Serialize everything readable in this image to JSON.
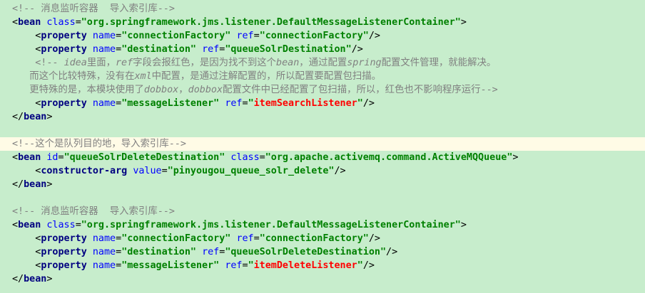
{
  "lines": [
    {
      "indent": 0,
      "tokens": [
        {
          "t": "comment",
          "s": "<!-- 消息监听容器  导入索引库-->"
        }
      ]
    },
    {
      "indent": 0,
      "tokens": [
        {
          "t": "punct",
          "s": "<"
        },
        {
          "t": "tag",
          "s": "bean"
        },
        {
          "t": "punct",
          "s": " "
        },
        {
          "t": "attr",
          "s": "class"
        },
        {
          "t": "punct",
          "s": "="
        },
        {
          "t": "val",
          "s": "\"org.springframework.jms.listener.DefaultMessageListenerContainer\""
        },
        {
          "t": "punct",
          "s": ">"
        }
      ]
    },
    {
      "indent": 4,
      "tokens": [
        {
          "t": "punct",
          "s": "<"
        },
        {
          "t": "tag",
          "s": "property"
        },
        {
          "t": "punct",
          "s": " "
        },
        {
          "t": "attr",
          "s": "name"
        },
        {
          "t": "punct",
          "s": "="
        },
        {
          "t": "val",
          "s": "\"connectionFactory\""
        },
        {
          "t": "punct",
          "s": " "
        },
        {
          "t": "attr",
          "s": "ref"
        },
        {
          "t": "punct",
          "s": "="
        },
        {
          "t": "val",
          "s": "\"connectionFactory\""
        },
        {
          "t": "punct",
          "s": "/>"
        }
      ]
    },
    {
      "indent": 4,
      "tokens": [
        {
          "t": "punct",
          "s": "<"
        },
        {
          "t": "tag",
          "s": "property"
        },
        {
          "t": "punct",
          "s": " "
        },
        {
          "t": "attr",
          "s": "name"
        },
        {
          "t": "punct",
          "s": "="
        },
        {
          "t": "val",
          "s": "\"destination\""
        },
        {
          "t": "punct",
          "s": " "
        },
        {
          "t": "attr",
          "s": "ref"
        },
        {
          "t": "punct",
          "s": "="
        },
        {
          "t": "val",
          "s": "\"queueSolrDestination\""
        },
        {
          "t": "punct",
          "s": "/>"
        }
      ]
    },
    {
      "indent": 4,
      "tokens": [
        {
          "t": "comment",
          "s": "<!-- "
        },
        {
          "t": "comment-i",
          "s": "idea"
        },
        {
          "t": "comment",
          "s": "里面，"
        },
        {
          "t": "comment-i",
          "s": "ref"
        },
        {
          "t": "comment",
          "s": "字段会报红色，是因为找不到这个"
        },
        {
          "t": "comment-i",
          "s": "bean"
        },
        {
          "t": "comment",
          "s": "，通过配置"
        },
        {
          "t": "comment-i",
          "s": "spring"
        },
        {
          "t": "comment",
          "s": "配置文件管理，就能解决。"
        }
      ]
    },
    {
      "indent": 3,
      "tokens": [
        {
          "t": "comment",
          "s": "而这个比较特殊，没有在"
        },
        {
          "t": "comment-i",
          "s": "xml"
        },
        {
          "t": "comment",
          "s": "中配置，是通过注解配置的，所以配置要配置包扫描。"
        }
      ]
    },
    {
      "indent": 3,
      "tokens": [
        {
          "t": "comment",
          "s": "更特殊的是，本模块使用了"
        },
        {
          "t": "comment-i",
          "s": "dobbox"
        },
        {
          "t": "comment",
          "s": "，"
        },
        {
          "t": "comment-i",
          "s": "dobbox"
        },
        {
          "t": "comment",
          "s": "配置文件中已经配置了包扫描，所以，红色也不影响程序运行-->"
        }
      ]
    },
    {
      "indent": 4,
      "tokens": [
        {
          "t": "punct",
          "s": "<"
        },
        {
          "t": "tag",
          "s": "property"
        },
        {
          "t": "punct",
          "s": " "
        },
        {
          "t": "attr",
          "s": "name"
        },
        {
          "t": "punct",
          "s": "="
        },
        {
          "t": "val",
          "s": "\"messageListener\""
        },
        {
          "t": "punct",
          "s": " "
        },
        {
          "t": "attr",
          "s": "ref"
        },
        {
          "t": "punct",
          "s": "="
        },
        {
          "t": "val",
          "s": "\""
        },
        {
          "t": "val-red",
          "s": "itemSearchListener"
        },
        {
          "t": "val",
          "s": "\""
        },
        {
          "t": "punct",
          "s": "/>"
        }
      ]
    },
    {
      "indent": 0,
      "tokens": [
        {
          "t": "punct",
          "s": "</"
        },
        {
          "t": "tag",
          "s": "bean"
        },
        {
          "t": "punct",
          "s": ">"
        }
      ]
    },
    {
      "indent": 0,
      "tokens": []
    },
    {
      "indent": 0,
      "current": true,
      "tokens": [
        {
          "t": "comment",
          "s": "<!--这个是队列目的地，导入索引库-->"
        }
      ]
    },
    {
      "indent": 0,
      "tokens": [
        {
          "t": "punct",
          "s": "<"
        },
        {
          "t": "tag",
          "s": "bean"
        },
        {
          "t": "punct",
          "s": " "
        },
        {
          "t": "attr",
          "s": "id"
        },
        {
          "t": "punct",
          "s": "="
        },
        {
          "t": "val",
          "s": "\"queueSolrDeleteDestination\""
        },
        {
          "t": "punct",
          "s": " "
        },
        {
          "t": "attr",
          "s": "class"
        },
        {
          "t": "punct",
          "s": "="
        },
        {
          "t": "val",
          "s": "\"org.apache.activemq.command.ActiveMQQueue\""
        },
        {
          "t": "punct",
          "s": ">"
        }
      ]
    },
    {
      "indent": 4,
      "tokens": [
        {
          "t": "punct",
          "s": "<"
        },
        {
          "t": "tag",
          "s": "constructor-arg"
        },
        {
          "t": "punct",
          "s": " "
        },
        {
          "t": "attr",
          "s": "value"
        },
        {
          "t": "punct",
          "s": "="
        },
        {
          "t": "val",
          "s": "\"pinyougou_queue_solr_delete\""
        },
        {
          "t": "punct",
          "s": "/>"
        }
      ]
    },
    {
      "indent": 0,
      "tokens": [
        {
          "t": "punct",
          "s": "</"
        },
        {
          "t": "tag",
          "s": "bean"
        },
        {
          "t": "punct",
          "s": ">"
        }
      ]
    },
    {
      "indent": 0,
      "tokens": []
    },
    {
      "indent": 0,
      "tokens": [
        {
          "t": "comment",
          "s": "<!-- 消息监听容器  导入索引库-->"
        }
      ]
    },
    {
      "indent": 0,
      "tokens": [
        {
          "t": "punct",
          "s": "<"
        },
        {
          "t": "tag",
          "s": "bean"
        },
        {
          "t": "punct",
          "s": " "
        },
        {
          "t": "attr",
          "s": "class"
        },
        {
          "t": "punct",
          "s": "="
        },
        {
          "t": "val",
          "s": "\"org.springframework.jms.listener.DefaultMessageListenerContainer\""
        },
        {
          "t": "punct",
          "s": ">"
        }
      ]
    },
    {
      "indent": 4,
      "tokens": [
        {
          "t": "punct",
          "s": "<"
        },
        {
          "t": "tag",
          "s": "property"
        },
        {
          "t": "punct",
          "s": " "
        },
        {
          "t": "attr",
          "s": "name"
        },
        {
          "t": "punct",
          "s": "="
        },
        {
          "t": "val",
          "s": "\"connectionFactory\""
        },
        {
          "t": "punct",
          "s": " "
        },
        {
          "t": "attr",
          "s": "ref"
        },
        {
          "t": "punct",
          "s": "="
        },
        {
          "t": "val",
          "s": "\"connectionFactory\""
        },
        {
          "t": "punct",
          "s": "/>"
        }
      ]
    },
    {
      "indent": 4,
      "tokens": [
        {
          "t": "punct",
          "s": "<"
        },
        {
          "t": "tag",
          "s": "property"
        },
        {
          "t": "punct",
          "s": " "
        },
        {
          "t": "attr",
          "s": "name"
        },
        {
          "t": "punct",
          "s": "="
        },
        {
          "t": "val",
          "s": "\"destination\""
        },
        {
          "t": "punct",
          "s": " "
        },
        {
          "t": "attr",
          "s": "ref"
        },
        {
          "t": "punct",
          "s": "="
        },
        {
          "t": "val",
          "s": "\"queueSolrDeleteDestination\""
        },
        {
          "t": "punct",
          "s": "/>"
        }
      ]
    },
    {
      "indent": 4,
      "tokens": [
        {
          "t": "punct",
          "s": "<"
        },
        {
          "t": "tag",
          "s": "property"
        },
        {
          "t": "punct",
          "s": " "
        },
        {
          "t": "attr",
          "s": "name"
        },
        {
          "t": "punct",
          "s": "="
        },
        {
          "t": "val",
          "s": "\"messageListener\""
        },
        {
          "t": "punct",
          "s": " "
        },
        {
          "t": "attr",
          "s": "ref"
        },
        {
          "t": "punct",
          "s": "="
        },
        {
          "t": "val",
          "s": "\""
        },
        {
          "t": "val-red",
          "s": "itemDeleteListener"
        },
        {
          "t": "val",
          "s": "\""
        },
        {
          "t": "punct",
          "s": "/>"
        }
      ]
    },
    {
      "indent": 0,
      "tokens": [
        {
          "t": "punct",
          "s": "</"
        },
        {
          "t": "tag",
          "s": "bean"
        },
        {
          "t": "punct",
          "s": ">"
        }
      ]
    }
  ]
}
